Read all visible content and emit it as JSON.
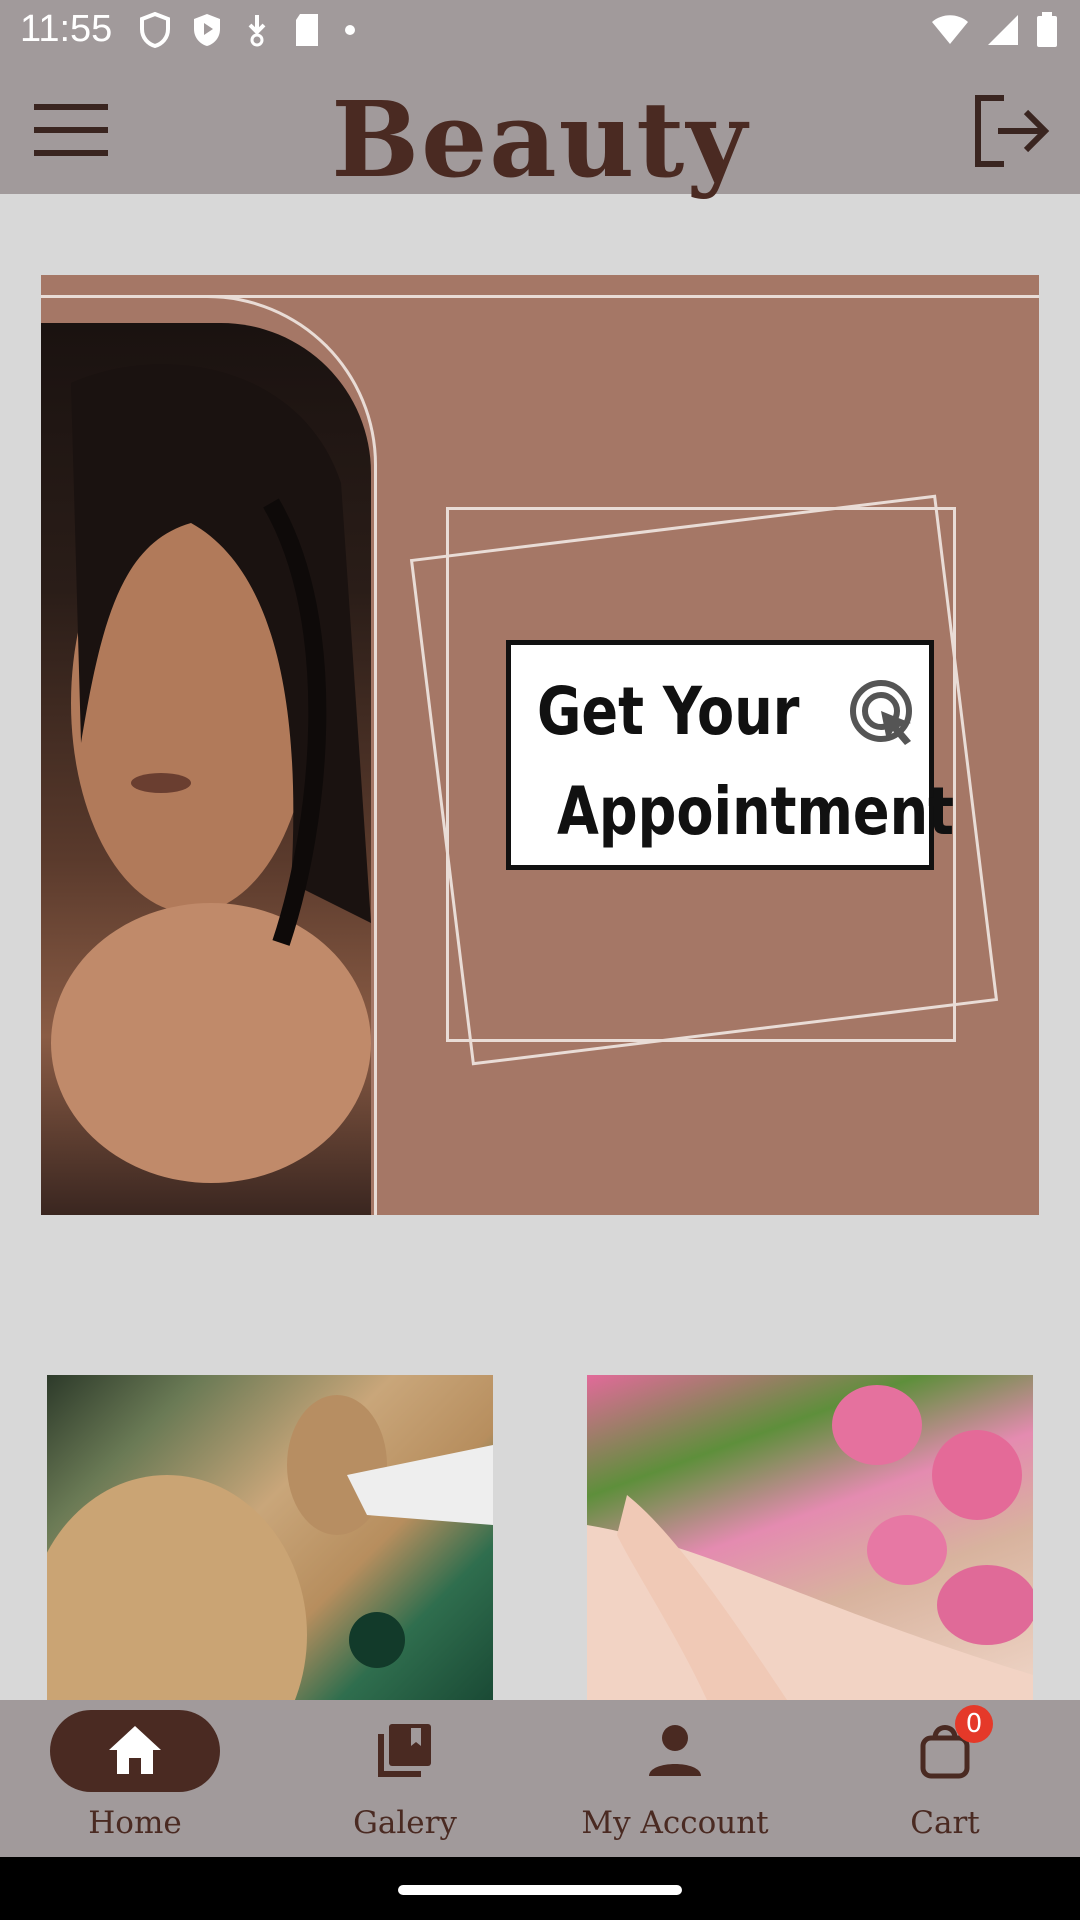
{
  "status_bar": {
    "time": "11:55",
    "icons": [
      "shield-icon",
      "play-protect-icon",
      "download-icon",
      "sd-card-icon",
      "dot-icon"
    ],
    "right_icons": [
      "wifi-icon",
      "signal-icon",
      "battery-icon"
    ]
  },
  "app_bar": {
    "title": "Beauty",
    "menu_icon": "hamburger-icon",
    "logout_icon": "logout-icon"
  },
  "banner": {
    "line1": "Get Your",
    "line2": "Appointment",
    "cta_icon": "click-icon"
  },
  "bottom_nav": {
    "items": [
      {
        "label": "Home",
        "icon": "home-icon",
        "active": true
      },
      {
        "label": "Galery",
        "icon": "gallery-icon",
        "active": false
      },
      {
        "label": "My Account",
        "icon": "person-icon",
        "active": false
      },
      {
        "label": "Cart",
        "icon": "cart-icon",
        "active": false
      }
    ],
    "cart_badge": "0"
  },
  "colors": {
    "bar": "#a19a9b",
    "brand_dark": "#4a2a22",
    "banner_bg": "#a57766",
    "badge": "#e53929"
  }
}
